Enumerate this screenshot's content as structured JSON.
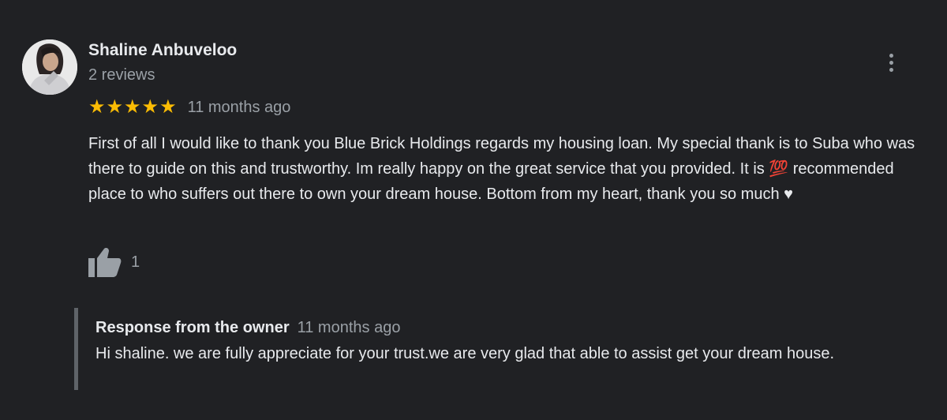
{
  "reviewer": {
    "name": "Shaline Anbuveloo",
    "review_count": "2 reviews",
    "avatar_icon": "profile-photo"
  },
  "menu": {
    "icon": "more-vert-icon"
  },
  "rating": {
    "stars": 5,
    "max_stars": 5,
    "star_glyph": "★",
    "star_color": "#fbbc04",
    "date": "11 months ago"
  },
  "review": {
    "text": "First of all I would like to thank you Blue Brick Holdings regards my housing loan. My special thank is to Suba who was there to guide on this and trustworthy. Im really happy on the great service that you provided. It is 💯 recommended place to who suffers out there to own your dream house. Bottom from my heart, thank you so much ♥"
  },
  "likes": {
    "icon": "thumbs-up-icon",
    "count": "1"
  },
  "owner_response": {
    "label": "Response from the owner",
    "date": "11 months ago",
    "text": "Hi shaline. we are fully appreciate for your trust.we are very glad that able to assist get your dream house."
  },
  "colors": {
    "background": "#202124",
    "primary_text": "#e8eaed",
    "secondary_text": "#9aa0a6",
    "star": "#fbbc04",
    "response_border": "#5f6368"
  }
}
